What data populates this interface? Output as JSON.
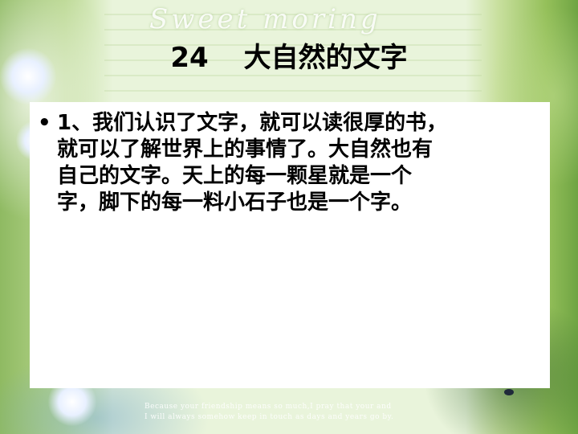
{
  "background": {
    "decorative_script": "Sweet moring",
    "footer_lines": [
      "Because your friendship means so much,I pray that your and",
      "I will always somehow keep in touch as days and years go by."
    ]
  },
  "slide": {
    "title_number": "24",
    "title_text": "大自然的文字",
    "bullet_char": "•",
    "paragraph_lines": [
      "1、我们认识了文字，就可以读很厚的书，",
      "就可以了解世界上的事情了。大自然也有",
      "自己的文字。天上的每一颗星就是一个",
      "字，脚下的每一料小石子也是一个字。"
    ]
  },
  "colors": {
    "title_text": "#000000",
    "panel_background": "#ffffff",
    "background_green": "#7fae5a"
  }
}
